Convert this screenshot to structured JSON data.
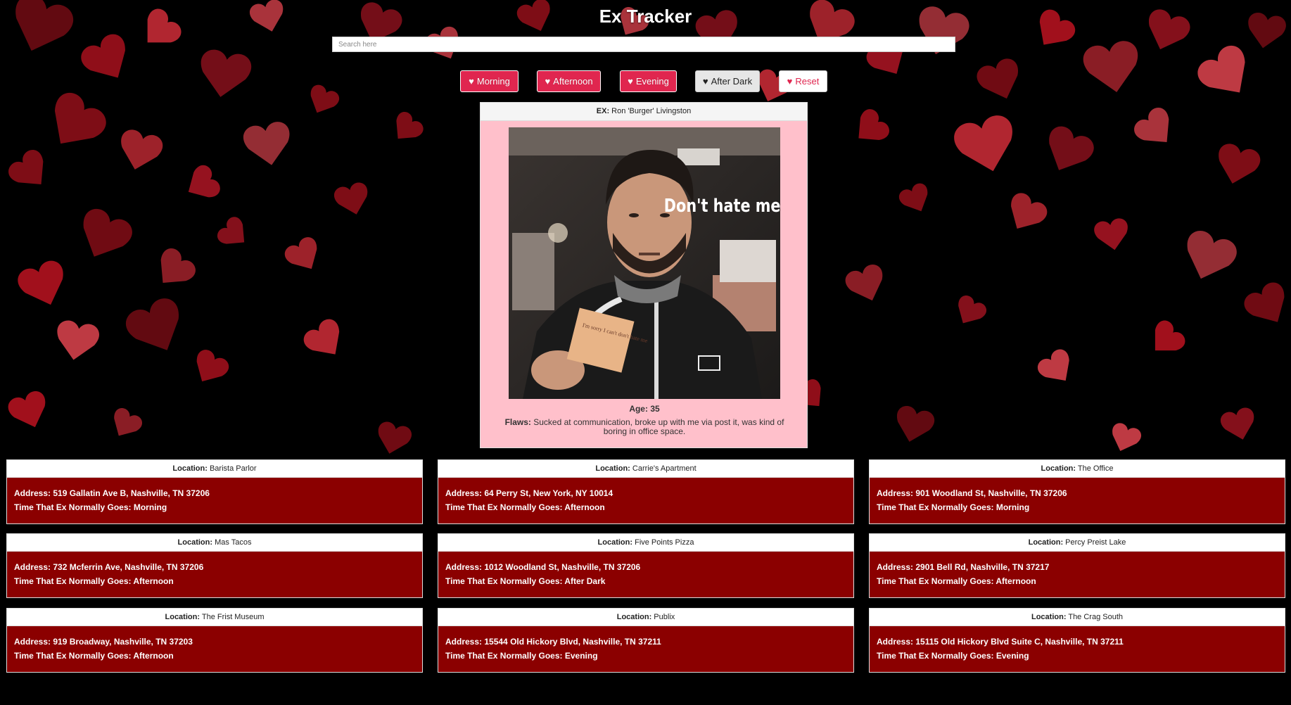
{
  "app": {
    "title": "Ex Tracker"
  },
  "search": {
    "placeholder": "Search here",
    "value": ""
  },
  "filters": [
    {
      "label": "Morning",
      "style": "pink",
      "icon": "heart-icon"
    },
    {
      "label": "Afternoon",
      "style": "pink",
      "icon": "heart-icon"
    },
    {
      "label": "Evening",
      "style": "pink",
      "icon": "heart-icon"
    },
    {
      "label": "After Dark",
      "style": "gray",
      "icon": "heart-icon"
    },
    {
      "label": "Reset",
      "style": "white",
      "icon": "heart-icon"
    }
  ],
  "profile": {
    "ex_label": "EX:",
    "ex_name": "Ron 'Burger' Livingston",
    "age_label": "Age:",
    "age": "35",
    "flaws_label": "Flaws:",
    "flaws": "Sucked at communication, broke up with me via post it, was kind of boring in office space.",
    "photo_caption": "Don't hate me",
    "note_text": "I'm sorry I can't don't hate me"
  },
  "labels": {
    "location": "Location:",
    "address": "Address:",
    "time": "Time That Ex Normally Goes:"
  },
  "locations": [
    {
      "name": "Barista Parlor",
      "address": "519 Gallatin Ave B, Nashville, TN 37206",
      "time": "Morning"
    },
    {
      "name": "Carrie's Apartment",
      "address": "64 Perry St, New York, NY 10014",
      "time": "Afternoon"
    },
    {
      "name": "The Office",
      "address": "901 Woodland St, Nashville, TN 37206",
      "time": "Morning"
    },
    {
      "name": "Mas Tacos",
      "address": "732 Mcferrin Ave, Nashville, TN 37206",
      "time": "Afternoon"
    },
    {
      "name": "Five Points Pizza",
      "address": "1012 Woodland St, Nashville, TN 37206",
      "time": "After Dark"
    },
    {
      "name": "Percy Preist Lake",
      "address": "2901 Bell Rd, Nashville, TN 37217",
      "time": "Afternoon"
    },
    {
      "name": "The Frist Museum",
      "address": "919 Broadway, Nashville, TN 37203",
      "time": "Afternoon"
    },
    {
      "name": "Publix",
      "address": "15544 Old Hickory Blvd, Nashville, TN 37211",
      "time": "Evening"
    },
    {
      "name": "The Crag South",
      "address": "15115 Old Hickory Blvd Suite C, Nashville, TN 37211",
      "time": "Evening"
    }
  ],
  "colors": {
    "background": "#000000",
    "heart_red": "#b3121f",
    "card_red": "#8b0000",
    "profile_pink": "#ffc0cb",
    "button_pink": "#e0264f"
  }
}
